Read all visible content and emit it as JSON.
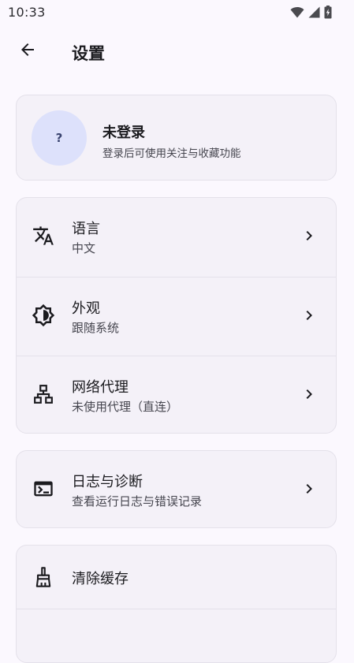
{
  "status_bar": {
    "time": "10:33",
    "icons": [
      "wifi-icon",
      "cellular-signal-icon",
      "battery-charging-icon"
    ]
  },
  "app_bar": {
    "title": "设置",
    "back_icon": "arrow-back-icon"
  },
  "account": {
    "avatar_text": "?",
    "name": "未登录",
    "description": "登录后可使用关注与收藏功能"
  },
  "settings_group_1": [
    {
      "icon": "translate-icon",
      "title": "语言",
      "subtitle": "中文"
    },
    {
      "icon": "brightness-auto-icon",
      "title": "外观",
      "subtitle": "跟随系统"
    },
    {
      "icon": "network-icon",
      "title": "网络代理",
      "subtitle": "未使用代理（直连）"
    }
  ],
  "settings_group_2": [
    {
      "icon": "terminal-icon",
      "title": "日志与诊断",
      "subtitle": "查看运行日志与错误记录"
    }
  ],
  "settings_group_3": [
    {
      "icon": "broom-icon",
      "title": "清除缓存"
    }
  ],
  "colors": {
    "background": "#fbf8fe",
    "card": "#f4f1f8",
    "avatar": "#dde1fb",
    "text_primary": "#1b1b1f",
    "text_secondary": "#46464f"
  }
}
